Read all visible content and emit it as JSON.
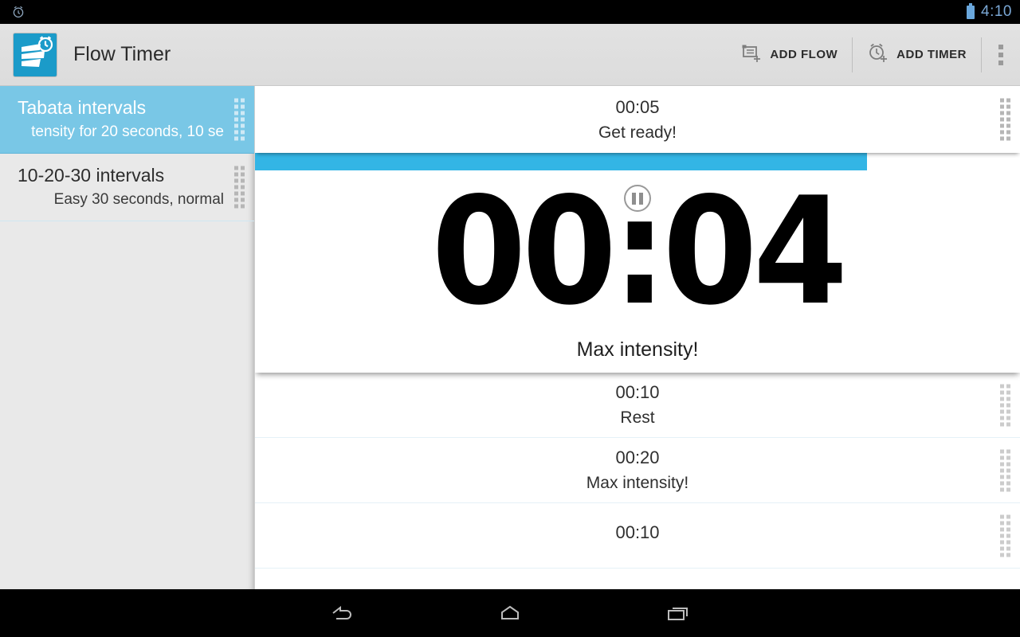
{
  "status_bar": {
    "alarm_icon": "alarm-clock-icon",
    "battery_icon": "battery-icon",
    "time": "4:10"
  },
  "action_bar": {
    "app_icon": "flow-timer-app-icon",
    "title": "Flow Timer",
    "add_flow_label": "ADD FLOW",
    "add_flow_icon": "add-flow-icon",
    "add_timer_label": "ADD TIMER",
    "add_timer_icon": "add-timer-icon",
    "overflow_icon": "overflow-menu-icon"
  },
  "sidebar": {
    "flows": [
      {
        "title": "Tabata intervals",
        "subtitle": "tensity for 20 seconds, 10 se",
        "selected": true,
        "handle_icon": "drag-handle-icon"
      },
      {
        "title": "10-20-30 intervals",
        "subtitle": "Easy 30 seconds, normal",
        "selected": false,
        "handle_icon": "drag-handle-icon"
      }
    ]
  },
  "main": {
    "previous_step": {
      "time": "00:05",
      "label": "Get ready!",
      "handle_icon": "drag-handle-icon"
    },
    "active_step": {
      "time": "00:04",
      "label": "Max intensity!",
      "pause_icon": "pause-icon",
      "progress_percent": 80,
      "accent_color": "#33b5e5"
    },
    "upcoming_steps": [
      {
        "time": "00:10",
        "label": "Rest",
        "handle_icon": "drag-handle-icon"
      },
      {
        "time": "00:20",
        "label": "Max intensity!",
        "handle_icon": "drag-handle-icon"
      },
      {
        "time": "00:10",
        "label": "",
        "handle_icon": "drag-handle-icon"
      }
    ]
  },
  "nav_bar": {
    "back_icon": "back-icon",
    "home_icon": "home-icon",
    "recents_icon": "recents-icon"
  },
  "colors": {
    "accent": "#33b5e5",
    "selection": "#79c7e6",
    "sidebar_bg": "#e9e9e9",
    "action_bar_bg": "#e0e0e0"
  }
}
